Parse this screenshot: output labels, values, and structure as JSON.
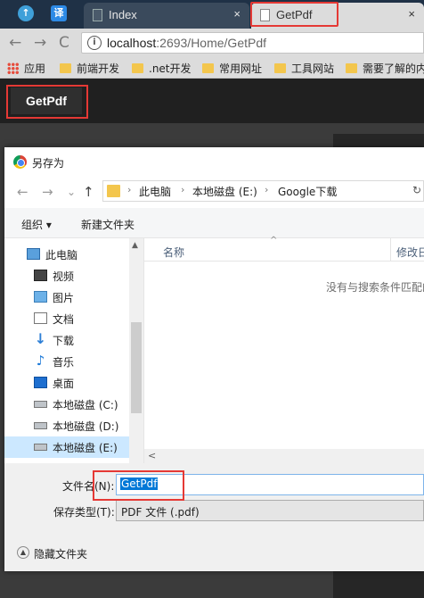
{
  "browser": {
    "extensions": [
      {
        "name": "up-arrow-extension",
        "glyph": "↑"
      },
      {
        "name": "translate-extension",
        "glyph": "译"
      }
    ],
    "tabs": [
      {
        "label": "Index",
        "close": "×"
      },
      {
        "label": "GetPdf",
        "close": "×"
      }
    ],
    "nav": {
      "back": "←",
      "forward": "→",
      "reload": "C"
    },
    "info_glyph": "i",
    "url_host": "localhost",
    "url_path": ":2693/Home/GetPdf",
    "bookmarks": [
      "应用",
      "前端开发",
      ".net开发",
      "常用网址",
      "工具网站",
      "需要了解的内"
    ]
  },
  "page": {
    "button_label": "GetPdf"
  },
  "dialog": {
    "title": "另存为",
    "nav": {
      "back": "←",
      "forward": "→",
      "dropdown": "⌄",
      "up": "↑"
    },
    "breadcrumbs": [
      "此电脑",
      "本地磁盘 (E:)",
      "Google下载"
    ],
    "breadcrumb_sep": "›",
    "refresh": "↻",
    "commands": {
      "organize": "组织 ▾",
      "new_folder": "新建文件夹"
    },
    "nav_items": [
      {
        "label": "此电脑",
        "icon": "computer-icon"
      },
      {
        "label": "视频",
        "icon": "video-folder-icon"
      },
      {
        "label": "图片",
        "icon": "pictures-folder-icon"
      },
      {
        "label": "文档",
        "icon": "documents-folder-icon"
      },
      {
        "label": "下载",
        "icon": "downloads-folder-icon",
        "glyph": "↓"
      },
      {
        "label": "音乐",
        "icon": "music-folder-icon",
        "glyph": "♪"
      },
      {
        "label": "桌面",
        "icon": "desktop-folder-icon"
      },
      {
        "label": "本地磁盘 (C:)",
        "icon": "drive-icon"
      },
      {
        "label": "本地磁盘 (D:)",
        "icon": "drive-icon"
      },
      {
        "label": "本地磁盘 (E:)",
        "icon": "drive-icon"
      }
    ],
    "scroll": {
      "up": "▲",
      "left": "<"
    },
    "sort_arrow": "^",
    "columns": [
      "名称",
      "修改日期"
    ],
    "empty_message": "没有与搜索条件匹配的项。",
    "filename_label": "文件名(N):",
    "filename_value": "GetPdf",
    "filetype_label": "保存类型(T):",
    "filetype_value": "PDF 文件 (.pdf)",
    "hide_folders_glyph": "▲",
    "hide_folders": "隐藏文件夹"
  }
}
